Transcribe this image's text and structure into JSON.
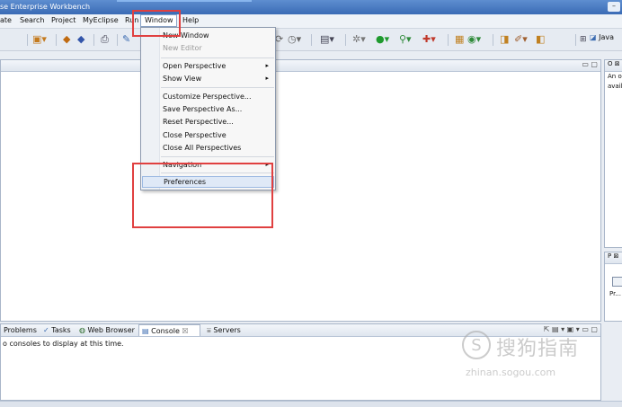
{
  "window": {
    "title": "se Enterprise Workbench",
    "control": "–"
  },
  "menubar": {
    "items": [
      "ate",
      "Search",
      "Project",
      "MyEclipse",
      "Run",
      "Window",
      "Help"
    ]
  },
  "toolbar": {
    "perspective": "Java"
  },
  "window_menu": {
    "new_window": "New Window",
    "new_editor": "New Editor",
    "open_perspective": "Open Perspective",
    "show_view": "Show View",
    "customize_perspective": "Customize Perspective...",
    "save_perspective_as": "Save Perspective As...",
    "reset_perspective": "Reset Perspective...",
    "close_perspective": "Close Perspective",
    "close_all_perspectives": "Close All Perspectives",
    "navigation": "Navigation",
    "preferences": "Preferences",
    "submenu_arrow": "▸"
  },
  "outline_panel": {
    "header": "O",
    "line1": "An o",
    "line2": "avail"
  },
  "properties_panel": {
    "header": "P",
    "text": "Pr..."
  },
  "bottom_panel": {
    "tabs": [
      "Problems",
      "Tasks",
      "Web Browser",
      "Console",
      "Servers"
    ],
    "console_message": "o consoles to display at this time."
  },
  "watermark": {
    "logo": "S",
    "text": "搜狗指南",
    "url": "zhinan.sogou.com"
  }
}
